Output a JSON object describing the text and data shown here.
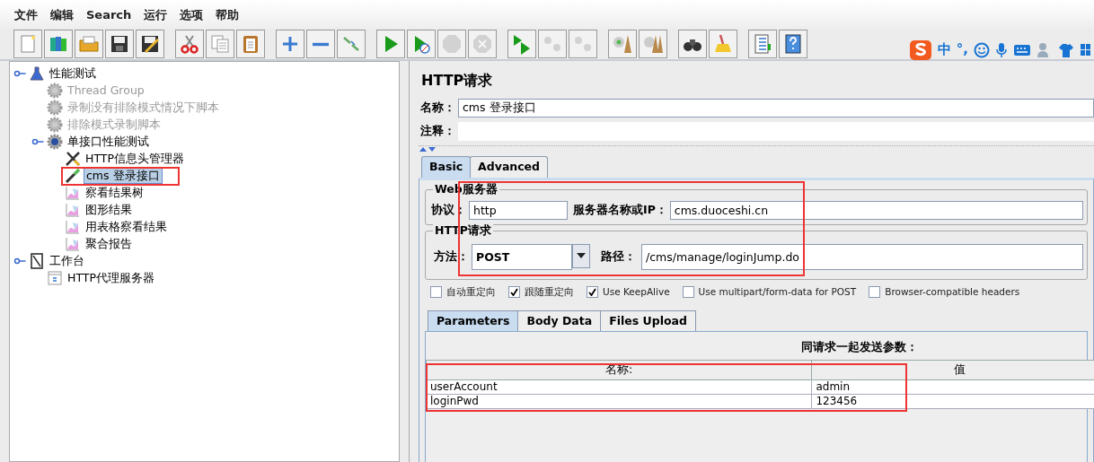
{
  "menu": [
    "文件",
    "编辑",
    "Search",
    "运行",
    "选项",
    "帮助"
  ],
  "toolbar": [
    [
      {
        "kind": "new",
        "disabled": false
      },
      {
        "kind": "templates",
        "disabled": false
      },
      {
        "kind": "open",
        "disabled": false
      },
      {
        "kind": "save",
        "disabled": false
      },
      {
        "kind": "saveas",
        "disabled": false
      }
    ],
    [
      {
        "kind": "cut",
        "disabled": false
      },
      {
        "kind": "copy",
        "disabled": false
      },
      {
        "kind": "paste",
        "disabled": false
      }
    ],
    [
      {
        "kind": "expand",
        "disabled": false
      },
      {
        "kind": "collapse",
        "disabled": false
      },
      {
        "kind": "toggle",
        "disabled": false
      }
    ],
    [
      {
        "kind": "start",
        "disabled": false
      },
      {
        "kind": "start-nopause",
        "disabled": false
      },
      {
        "kind": "stop",
        "disabled": true
      },
      {
        "kind": "shutdown",
        "disabled": true
      }
    ],
    [
      {
        "kind": "remote-start",
        "disabled": false
      },
      {
        "kind": "remote-stop",
        "disabled": true
      },
      {
        "kind": "remote-shutdown",
        "disabled": true
      }
    ],
    [
      {
        "kind": "clear",
        "disabled": false
      },
      {
        "kind": "clear-all",
        "disabled": false
      }
    ],
    [
      {
        "kind": "search",
        "disabled": false
      },
      {
        "kind": "reset",
        "disabled": false
      }
    ],
    [
      {
        "kind": "functions",
        "disabled": false
      },
      {
        "kind": "help",
        "disabled": false
      }
    ]
  ],
  "ime": {
    "mode": "中",
    "punct": "°,"
  },
  "tree": [
    {
      "label": "性能测试",
      "kind": "plan",
      "disabled": false,
      "selected": false,
      "children": [
        {
          "label": "Thread Group",
          "kind": "group",
          "disabled": true,
          "selected": false
        },
        {
          "label": "录制没有排除模式情况下脚本",
          "kind": "group",
          "disabled": true,
          "selected": false
        },
        {
          "label": "排除模式录制脚本",
          "kind": "group",
          "disabled": true,
          "selected": false
        },
        {
          "label": "单接口性能测试",
          "kind": "group",
          "disabled": false,
          "selected": false,
          "children": [
            {
              "label": "HTTP信息头管理器",
              "kind": "config",
              "disabled": false,
              "selected": false
            },
            {
              "label": "cms 登录接口",
              "kind": "sampler",
              "disabled": false,
              "selected": true
            },
            {
              "label": "察看结果树",
              "kind": "listener",
              "disabled": false,
              "selected": false
            },
            {
              "label": "图形结果",
              "kind": "listener",
              "disabled": false,
              "selected": false
            },
            {
              "label": "用表格察看结果",
              "kind": "listener",
              "disabled": false,
              "selected": false
            },
            {
              "label": "聚合报告",
              "kind": "listener",
              "disabled": false,
              "selected": false
            }
          ]
        }
      ]
    },
    {
      "label": "工作台",
      "kind": "workbench",
      "disabled": false,
      "selected": false,
      "children": [
        {
          "label": "HTTP代理服务器",
          "kind": "proxy",
          "disabled": false,
          "selected": false
        }
      ]
    }
  ],
  "editor": {
    "title": "HTTP请求",
    "name_label": "名称：",
    "name_value": "cms 登录接口",
    "comment_label": "注释：",
    "tabs": [
      {
        "label": "Basic",
        "selected": true
      },
      {
        "label": "Advanced",
        "selected": false
      }
    ],
    "web_server": {
      "legend": "Web服务器",
      "protocol_label": "协议：",
      "protocol": "http",
      "server_label": "服务器名称或IP：",
      "server": "cms.duoceshi.cn"
    },
    "http_request": {
      "legend": "HTTP请求",
      "method_label": "方法：",
      "method": "POST",
      "path_label": "路径：",
      "path": "/cms/manage/loginJump.do"
    },
    "options": [
      {
        "label": "自动重定向",
        "checked": false
      },
      {
        "label": "跟随重定向",
        "checked": true
      },
      {
        "label": "Use KeepAlive",
        "checked": true
      },
      {
        "label": "Use multipart/form-data for POST",
        "checked": false
      },
      {
        "label": "Browser-compatible headers",
        "checked": false
      }
    ],
    "param_tabs": [
      {
        "label": "Parameters",
        "selected": true
      },
      {
        "label": "Body Data",
        "selected": false
      },
      {
        "label": "Files Upload",
        "selected": false
      }
    ],
    "params_caption": "同请求一起发送参数：",
    "columns": [
      "名称:",
      "值"
    ],
    "rows": [
      [
        "userAccount",
        "admin"
      ],
      [
        "loginPwd",
        "123456"
      ]
    ]
  },
  "annotation_boxes": [
    {
      "kind": "tree"
    },
    {
      "kind": "request"
    },
    {
      "kind": "params"
    }
  ]
}
